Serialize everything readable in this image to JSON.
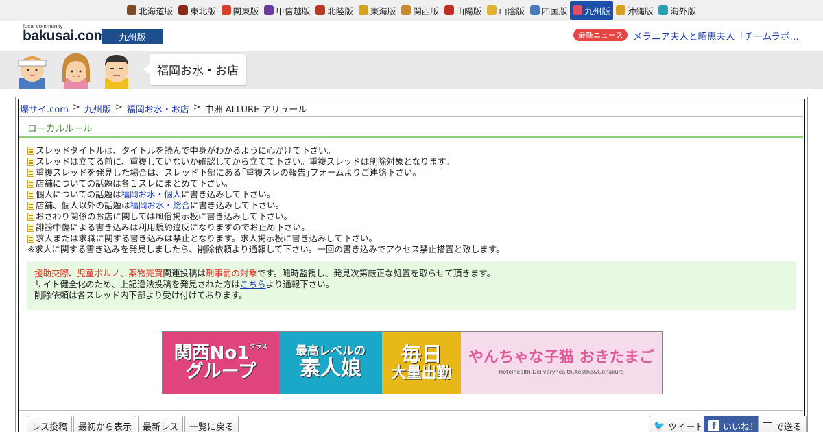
{
  "regions": [
    {
      "label": "北海道版",
      "icon": "cow-icon",
      "color": "#7a4a2a"
    },
    {
      "label": "東北版",
      "icon": "namahage-icon",
      "color": "#8a2a1a"
    },
    {
      "label": "関東版",
      "icon": "tokyo-tower-icon",
      "color": "#d8402a"
    },
    {
      "label": "甲信越版",
      "icon": "grape-icon",
      "color": "#6a3aa0"
    },
    {
      "label": "北陸版",
      "icon": "gate-icon",
      "color": "#b83a24"
    },
    {
      "label": "東海版",
      "icon": "shachihoko-icon",
      "color": "#d6a21e"
    },
    {
      "label": "関西版",
      "icon": "takoyaki-icon",
      "color": "#c88a30"
    },
    {
      "label": "山陽版",
      "icon": "castle-icon",
      "color": "#c0302a"
    },
    {
      "label": "山陰版",
      "icon": "mask-icon",
      "color": "#e0b030"
    },
    {
      "label": "四国版",
      "icon": "udon-icon",
      "color": "#4a7ac0"
    },
    {
      "label": "九州版",
      "icon": "fish-icon",
      "color": "#e05060",
      "active": true
    },
    {
      "label": "沖縄版",
      "icon": "shisa-icon",
      "color": "#d8a020"
    },
    {
      "label": "海外版",
      "icon": "globe-icon",
      "color": "#2aa0b0"
    }
  ],
  "logo": {
    "small": "local community",
    "main": "bakusai.com"
  },
  "edition": "九州版",
  "news": {
    "label": "最新ニュース",
    "text": "メラニア夫人と昭恵夫人「チームラボ…"
  },
  "banner": {
    "board_name": "福岡お水・お店"
  },
  "breadcrumb": {
    "items": [
      "爆サイ.com",
      "九州版",
      "福岡お水・お店"
    ],
    "current": "中洲 ALLURE アリュール",
    "sep": ">"
  },
  "local_rules": {
    "title": "ローカルルール",
    "rules": [
      {
        "text": "スレッドタイトルは、タイトルを読んで中身がわかるように心がけて下さい。"
      },
      {
        "text": "スレッドは立てる前に、重複していないか確認してから立てて下さい。重複スレッドは削除対象となります。"
      },
      {
        "text": "重複スレッドを発見した場合は、スレッド下部にある｢重複スレの報告｣フォームよりご連絡下さい。"
      },
      {
        "text": "店舗についての話題は各１スレにまとめて下さい。"
      },
      {
        "pre": "個人についての話題は",
        "link": "福岡お水・個人",
        "post": "に書き込みして下さい。"
      },
      {
        "pre": "店舗、個人以外の話題は",
        "link": "福岡お水・総合",
        "post": "に書き込みして下さい。"
      },
      {
        "text": "おさわり関係のお店に関しては風俗掲示板に書き込みして下さい。"
      },
      {
        "text": "誹謗中傷による書き込みは利用規約違反になりますのでお止め下さい。"
      },
      {
        "text": "求人または求職に関する書き込みは禁止となります。求人掲示板に書き込みして下さい。"
      }
    ],
    "note": "※求人に関する書き込みを発見しましたら、削除依頼より通報して下さい。一回の書き込みでアクセス禁止措置と致します。"
  },
  "warning": {
    "w1": "援助交際",
    "sep1": "、",
    "w2": "児童ポルノ",
    "sep2": "、",
    "w3": "薬物売買",
    "mid": "関連投稿は",
    "w4": "刑事罰の対象",
    "end": "です。随時監視し、発見次第厳正な処置を取らせて頂きます。",
    "line2_pre": "サイト健全化のため、上記違法投稿を発見された方は",
    "line2_link": "こちら",
    "line2_post": "より通報下さい。",
    "line3": "削除依頼は各スレッド内下部より受け付けております。"
  },
  "ad": {
    "seg1_top": "関西No1",
    "seg1_sup": "クラス",
    "seg1_bottom": "グループ",
    "seg2_top": "最高レベルの",
    "seg2_bottom": "素人娘",
    "seg3_top": "毎日",
    "seg3_bottom": "大量出勤",
    "seg4_main": "やんちゃな子猫 おきたまご",
    "seg4_sub": "Hotelhealth.Deliveryhealth.Aesthe&Gonakura",
    "colors": {
      "seg1": "#e0447c",
      "seg2": "#1aa7c8",
      "seg3": "#e8b818",
      "seg4": "#f6dceb"
    }
  },
  "buttons": {
    "post": "レス投稿",
    "from_start": "最初から表示",
    "latest": "最新レス",
    "back": "一覧に戻る",
    "tweet": "ツイート",
    "like": "いいね！",
    "send": "で送る"
  }
}
